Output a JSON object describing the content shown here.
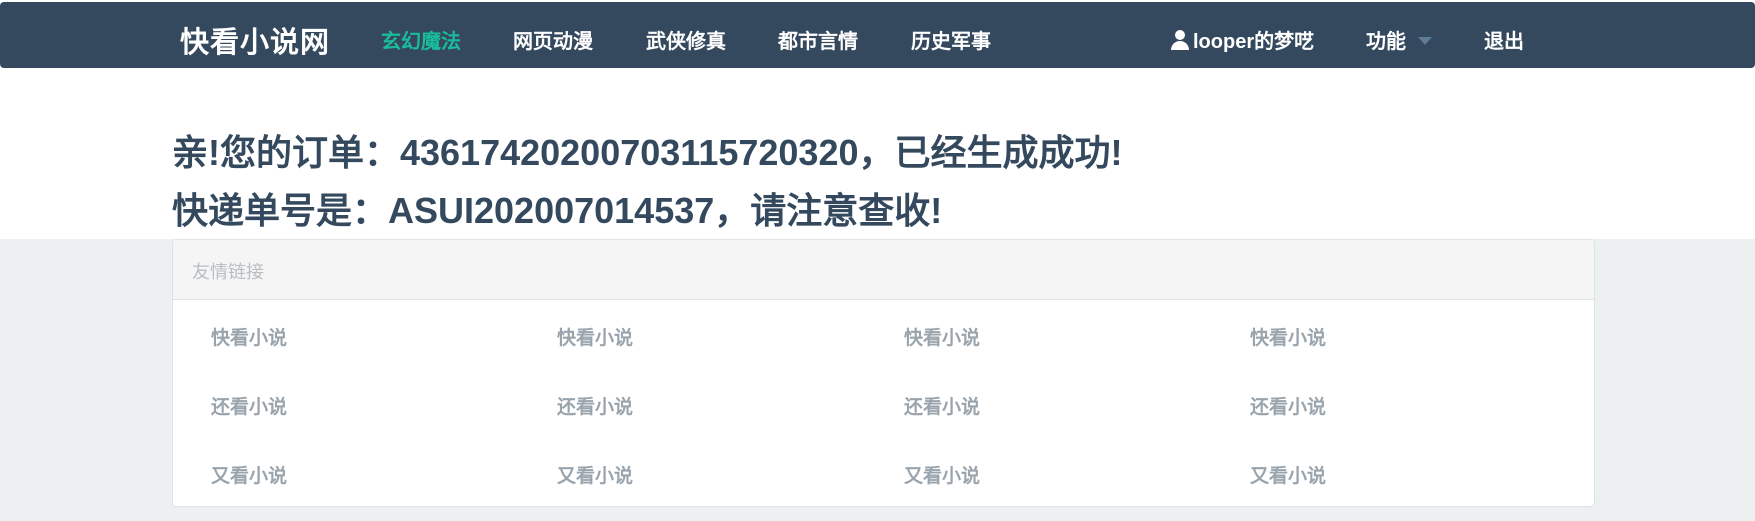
{
  "navbar": {
    "brand": "快看小说网",
    "items": [
      "玄幻魔法",
      "网页动漫",
      "武侠修真",
      "都市言情",
      "历史军事"
    ],
    "user_label": "looper的梦呓",
    "functions_label": "功能",
    "logout_label": "退出",
    "accent_color": "#1abc9c",
    "bar_color": "#34495e"
  },
  "message": {
    "line1": "亲!您的订单：43617420200703115720320，已经生成成功!",
    "line2": "快递单号是：ASUI202007014537，请注意查收!"
  },
  "links_panel": {
    "heading": "友情链接",
    "rows": [
      [
        "快看小说",
        "快看小说",
        "快看小说",
        "快看小说"
      ],
      [
        "还看小说",
        "还看小说",
        "还看小说",
        "还看小说"
      ],
      [
        "又看小说",
        "又看小说",
        "又看小说",
        "又看小说"
      ]
    ]
  }
}
